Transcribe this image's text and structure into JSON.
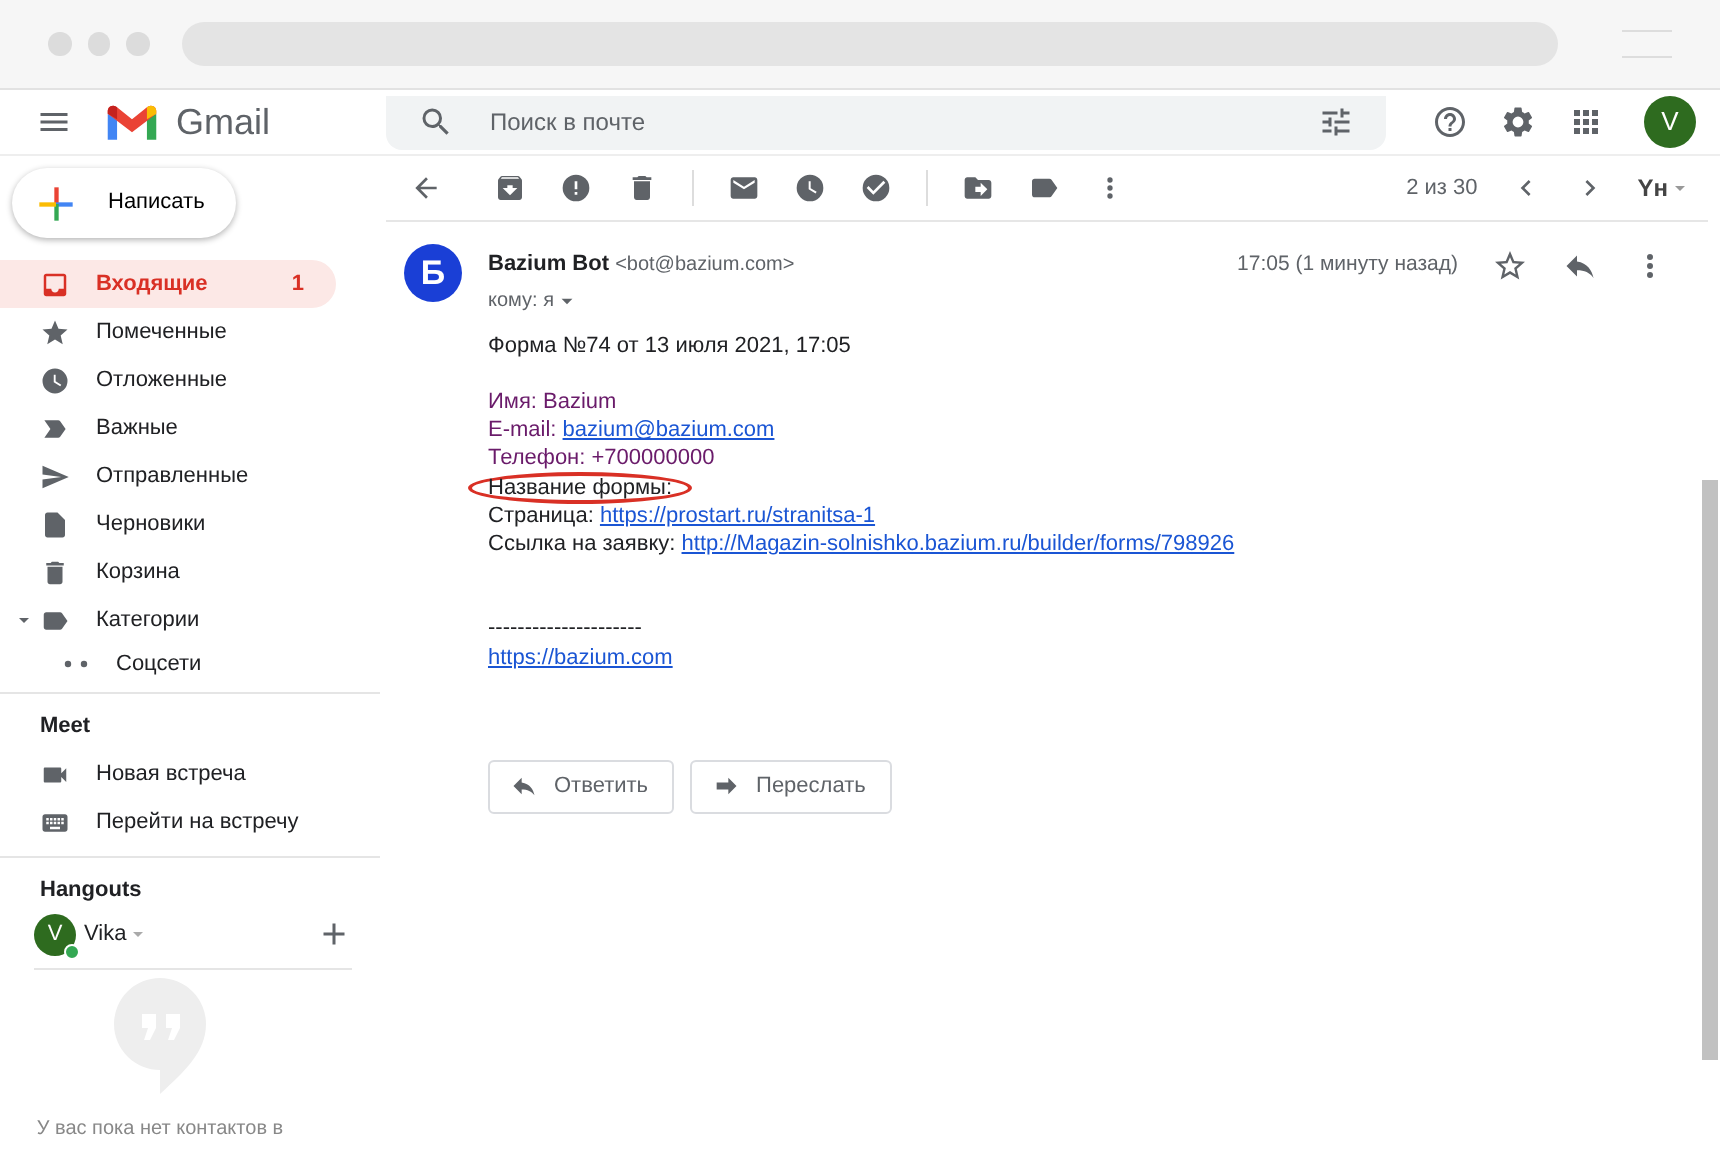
{
  "app": {
    "name": "Gmail"
  },
  "search": {
    "placeholder": "Поиск в почте"
  },
  "account": {
    "initial": "V"
  },
  "compose": {
    "label": "Написать"
  },
  "sidebar": {
    "items": [
      {
        "label": "Входящие",
        "count": "1",
        "selected": true
      },
      {
        "label": "Помеченные",
        "selected": false
      },
      {
        "label": "Отложенные",
        "selected": false
      },
      {
        "label": "Важные",
        "selected": false
      },
      {
        "label": "Отправленные",
        "selected": false
      },
      {
        "label": "Черновики",
        "selected": false
      },
      {
        "label": "Корзина",
        "selected": false
      },
      {
        "label": "Категории",
        "selected": false,
        "expanded": true,
        "children": [
          {
            "label": "Соцсети",
            "selected": false
          }
        ]
      }
    ]
  },
  "meet": {
    "title": "Meet",
    "items": [
      "Новая встреча",
      "Перейти на встречу"
    ]
  },
  "hangouts": {
    "title": "Hangouts",
    "user": {
      "initial": "V",
      "name": "Vika",
      "online": true
    },
    "empty_text": "У вас пока нет контактов в"
  },
  "toolbar": {
    "counter": "2 из 30",
    "input_tool": "Yн"
  },
  "message": {
    "sender": "Bazium Bot",
    "sender_email": "<bot@bazium.com>",
    "avatar_letter": "Б",
    "recipient": "кому: я",
    "time": "17:05 (1 минуту назад)",
    "starred": false,
    "lines": [
      {
        "kind": "plain",
        "text": "Форма №74 от 13 июля 2021, 17:05"
      },
      {
        "kind": "blank"
      },
      {
        "kind": "accent",
        "text": "Имя: Bazium"
      },
      {
        "kind": "accent",
        "text": "E-mail:",
        "link": "bazium@bazium.com"
      },
      {
        "kind": "accent",
        "text": "Телефон: +700000000"
      },
      {
        "kind": "circled",
        "text": "Название формы:"
      },
      {
        "kind": "plain",
        "text": "Страница:",
        "link": "https://prostart.ru/stranitsa-1"
      },
      {
        "kind": "plain",
        "text": "Ссылка на заявку:",
        "link": "http://Magazin-solnishko.bazium.ru/builder/forms/798926"
      },
      {
        "kind": "blank"
      },
      {
        "kind": "blank"
      },
      {
        "kind": "plain",
        "text": "---------------------"
      },
      {
        "kind": "plain",
        "link": "https://bazium.com"
      }
    ]
  },
  "actions": [
    "Ответить",
    "Переслать"
  ]
}
